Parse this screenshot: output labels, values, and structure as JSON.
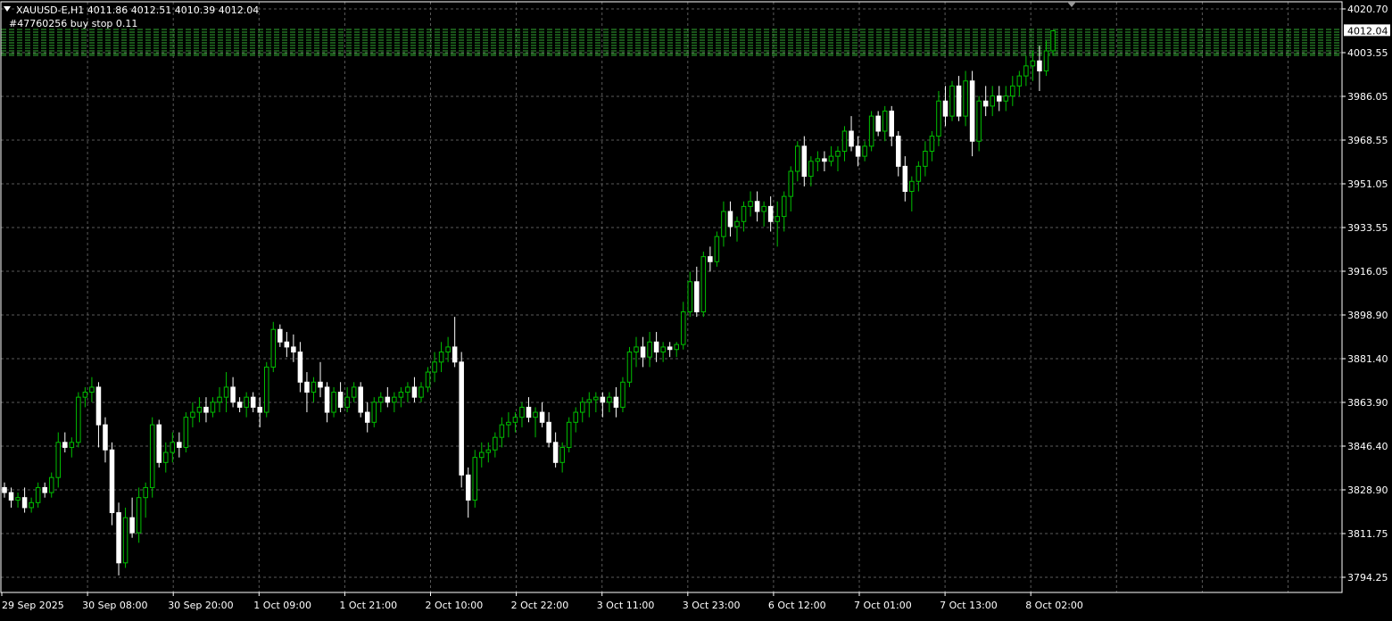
{
  "header": {
    "arrow_icon": "triangle-down-icon",
    "symbol_line": "XAUUSD-E,H1  4011.86 4012.51 4010.39 4012.04",
    "order_label": "#47760256 buy stop 0.11"
  },
  "colors": {
    "background": "#000000",
    "grid": "#5a5a5a",
    "bull_body": "#000000",
    "bear_body": "#ffffff",
    "wick_up": "#00c000",
    "wick_down": "#ffffff",
    "order_lines": "#33aa33",
    "price_tag_bg": "#ffffff",
    "price_tag_text": "#000000",
    "axis_text": "#ffffff"
  },
  "price_tag": "4012.04",
  "chart_data": {
    "type": "candlestick",
    "symbol": "XAUUSD-E",
    "timeframe": "H1",
    "ylim": [
      3794.25,
      4020.7
    ],
    "y_tick_labels": [
      "4020.70",
      "4003.55",
      "3986.05",
      "3968.55",
      "3951.05",
      "3933.55",
      "3916.05",
      "3898.90",
      "3881.40",
      "3863.90",
      "3846.40",
      "3828.90",
      "3811.75",
      "3794.25"
    ],
    "x_tick_labels": [
      "29 Sep 2025",
      "30 Sep 08:00",
      "30 Sep 20:00",
      "1 Oct 09:00",
      "1 Oct 21:00",
      "2 Oct 10:00",
      "2 Oct 22:00",
      "3 Oct 11:00",
      "3 Oct 23:00",
      "6 Oct 12:00",
      "7 Oct 01:00",
      "7 Oct 13:00",
      "8 Oct 02:00"
    ],
    "grid": true,
    "ohlc": [
      [
        3830,
        3832,
        3826,
        3828
      ],
      [
        3828,
        3830,
        3822,
        3825
      ],
      [
        3825,
        3828,
        3822,
        3826
      ],
      [
        3826,
        3830,
        3820,
        3822
      ],
      [
        3822,
        3826,
        3820,
        3824
      ],
      [
        3824,
        3832,
        3822,
        3830
      ],
      [
        3830,
        3832,
        3826,
        3828
      ],
      [
        3828,
        3836,
        3826,
        3834
      ],
      [
        3834,
        3852,
        3830,
        3848
      ],
      [
        3848,
        3852,
        3844,
        3846
      ],
      [
        3846,
        3850,
        3842,
        3848
      ],
      [
        3848,
        3868,
        3846,
        3866
      ],
      [
        3866,
        3870,
        3862,
        3868
      ],
      [
        3868,
        3874,
        3864,
        3870
      ],
      [
        3870,
        3872,
        3846,
        3855
      ],
      [
        3855,
        3858,
        3840,
        3845
      ],
      [
        3845,
        3848,
        3815,
        3820
      ],
      [
        3820,
        3824,
        3795,
        3800
      ],
      [
        3800,
        3822,
        3798,
        3818
      ],
      [
        3818,
        3826,
        3810,
        3812
      ],
      [
        3812,
        3830,
        3808,
        3826
      ],
      [
        3826,
        3832,
        3818,
        3830
      ],
      [
        3830,
        3858,
        3826,
        3855
      ],
      [
        3855,
        3857,
        3838,
        3840
      ],
      [
        3840,
        3848,
        3836,
        3844
      ],
      [
        3844,
        3852,
        3840,
        3848
      ],
      [
        3848,
        3852,
        3842,
        3846
      ],
      [
        3846,
        3860,
        3844,
        3858
      ],
      [
        3858,
        3864,
        3854,
        3860
      ],
      [
        3860,
        3866,
        3856,
        3862
      ],
      [
        3862,
        3866,
        3856,
        3860
      ],
      [
        3860,
        3866,
        3858,
        3864
      ],
      [
        3864,
        3870,
        3860,
        3866
      ],
      [
        3866,
        3876,
        3860,
        3870
      ],
      [
        3870,
        3874,
        3862,
        3864
      ],
      [
        3864,
        3866,
        3860,
        3862
      ],
      [
        3862,
        3868,
        3858,
        3866
      ],
      [
        3866,
        3868,
        3860,
        3862
      ],
      [
        3862,
        3866,
        3854,
        3860
      ],
      [
        3860,
        3880,
        3858,
        3878
      ],
      [
        3878,
        3896,
        3876,
        3893
      ],
      [
        3893,
        3895,
        3886,
        3888
      ],
      [
        3888,
        3892,
        3882,
        3886
      ],
      [
        3886,
        3891,
        3880,
        3884
      ],
      [
        3884,
        3888,
        3868,
        3872
      ],
      [
        3872,
        3876,
        3860,
        3868
      ],
      [
        3868,
        3874,
        3864,
        3872
      ],
      [
        3872,
        3880,
        3866,
        3870
      ],
      [
        3870,
        3872,
        3856,
        3860
      ],
      [
        3860,
        3870,
        3858,
        3868
      ],
      [
        3868,
        3872,
        3860,
        3862
      ],
      [
        3862,
        3870,
        3860,
        3866
      ],
      [
        3866,
        3872,
        3864,
        3870
      ],
      [
        3870,
        3872,
        3858,
        3860
      ],
      [
        3860,
        3864,
        3852,
        3856
      ],
      [
        3856,
        3866,
        3854,
        3864
      ],
      [
        3864,
        3868,
        3860,
        3866
      ],
      [
        3866,
        3870,
        3862,
        3864
      ],
      [
        3864,
        3868,
        3860,
        3866
      ],
      [
        3866,
        3870,
        3862,
        3868
      ],
      [
        3868,
        3872,
        3864,
        3870
      ],
      [
        3870,
        3874,
        3864,
        3866
      ],
      [
        3866,
        3872,
        3864,
        3870
      ],
      [
        3870,
        3878,
        3868,
        3876
      ],
      [
        3876,
        3884,
        3872,
        3880
      ],
      [
        3880,
        3888,
        3876,
        3884
      ],
      [
        3884,
        3890,
        3880,
        3886
      ],
      [
        3886,
        3898,
        3878,
        3880
      ],
      [
        3880,
        3884,
        3830,
        3835
      ],
      [
        3835,
        3838,
        3818,
        3825
      ],
      [
        3825,
        3845,
        3822,
        3842
      ],
      [
        3842,
        3848,
        3838,
        3844
      ],
      [
        3844,
        3848,
        3840,
        3845
      ],
      [
        3845,
        3852,
        3842,
        3850
      ],
      [
        3850,
        3858,
        3846,
        3855
      ],
      [
        3855,
        3860,
        3850,
        3856
      ],
      [
        3856,
        3860,
        3852,
        3858
      ],
      [
        3858,
        3864,
        3854,
        3862
      ],
      [
        3862,
        3866,
        3856,
        3858
      ],
      [
        3858,
        3862,
        3850,
        3860
      ],
      [
        3860,
        3864,
        3854,
        3856
      ],
      [
        3856,
        3860,
        3846,
        3848
      ],
      [
        3848,
        3852,
        3838,
        3840
      ],
      [
        3840,
        3848,
        3836,
        3846
      ],
      [
        3846,
        3858,
        3844,
        3856
      ],
      [
        3856,
        3862,
        3852,
        3860
      ],
      [
        3860,
        3866,
        3856,
        3864
      ],
      [
        3864,
        3868,
        3858,
        3865
      ],
      [
        3865,
        3868,
        3860,
        3866
      ],
      [
        3866,
        3868,
        3858,
        3864
      ],
      [
        3864,
        3868,
        3860,
        3866
      ],
      [
        3866,
        3870,
        3858,
        3862
      ],
      [
        3862,
        3874,
        3860,
        3872
      ],
      [
        3872,
        3886,
        3870,
        3884
      ],
      [
        3884,
        3890,
        3878,
        3886
      ],
      [
        3886,
        3890,
        3878,
        3882
      ],
      [
        3882,
        3892,
        3878,
        3888
      ],
      [
        3888,
        3892,
        3880,
        3884
      ],
      [
        3884,
        3888,
        3880,
        3886
      ],
      [
        3886,
        3888,
        3882,
        3885
      ],
      [
        3885,
        3888,
        3882,
        3887
      ],
      [
        3887,
        3904,
        3885,
        3900
      ],
      [
        3900,
        3916,
        3898,
        3912
      ],
      [
        3912,
        3918,
        3898,
        3900
      ],
      [
        3900,
        3924,
        3898,
        3922
      ],
      [
        3922,
        3926,
        3916,
        3920
      ],
      [
        3920,
        3932,
        3918,
        3930
      ],
      [
        3930,
        3944,
        3926,
        3940
      ],
      [
        3940,
        3944,
        3930,
        3934
      ],
      [
        3934,
        3938,
        3928,
        3936
      ],
      [
        3936,
        3944,
        3932,
        3942
      ],
      [
        3942,
        3948,
        3938,
        3944
      ],
      [
        3944,
        3948,
        3936,
        3940
      ],
      [
        3940,
        3944,
        3934,
        3942
      ],
      [
        3942,
        3946,
        3932,
        3936
      ],
      [
        3936,
        3944,
        3926,
        3938
      ],
      [
        3938,
        3948,
        3932,
        3946
      ],
      [
        3946,
        3958,
        3940,
        3956
      ],
      [
        3956,
        3968,
        3952,
        3966
      ],
      [
        3966,
        3970,
        3950,
        3954
      ],
      [
        3954,
        3962,
        3950,
        3960
      ],
      [
        3960,
        3964,
        3956,
        3961
      ],
      [
        3961,
        3964,
        3956,
        3960
      ],
      [
        3960,
        3966,
        3958,
        3962
      ],
      [
        3962,
        3966,
        3956,
        3964
      ],
      [
        3964,
        3974,
        3960,
        3972
      ],
      [
        3972,
        3978,
        3964,
        3966
      ],
      [
        3966,
        3970,
        3958,
        3962
      ],
      [
        3962,
        3968,
        3960,
        3966
      ],
      [
        3966,
        3980,
        3964,
        3978
      ],
      [
        3978,
        3980,
        3970,
        3972
      ],
      [
        3972,
        3982,
        3968,
        3980
      ],
      [
        3980,
        3982,
        3966,
        3970
      ],
      [
        3970,
        3972,
        3954,
        3958
      ],
      [
        3958,
        3962,
        3944,
        3948
      ],
      [
        3948,
        3954,
        3940,
        3952
      ],
      [
        3952,
        3960,
        3948,
        3958
      ],
      [
        3958,
        3968,
        3954,
        3964
      ],
      [
        3964,
        3972,
        3960,
        3970
      ],
      [
        3970,
        3988,
        3966,
        3984
      ],
      [
        3984,
        3990,
        3974,
        3978
      ],
      [
        3978,
        3992,
        3976,
        3990
      ],
      [
        3990,
        3994,
        3976,
        3978
      ],
      [
        3978,
        3996,
        3974,
        3992
      ],
      [
        3992,
        3996,
        3962,
        3968
      ],
      [
        3968,
        3986,
        3964,
        3984
      ],
      [
        3984,
        3990,
        3978,
        3982
      ],
      [
        3982,
        3990,
        3978,
        3986
      ],
      [
        3986,
        3990,
        3980,
        3984
      ],
      [
        3984,
        3990,
        3980,
        3986
      ],
      [
        3986,
        3994,
        3982,
        3990
      ],
      [
        3990,
        3996,
        3986,
        3994
      ],
      [
        3994,
        4002,
        3990,
        3998
      ],
      [
        3998,
        4004,
        3992,
        4000
      ],
      [
        4000,
        4006,
        3988,
        3996
      ],
      [
        3996,
        4008,
        3994,
        4004
      ],
      [
        4004,
        4012,
        4002,
        4012
      ]
    ]
  }
}
